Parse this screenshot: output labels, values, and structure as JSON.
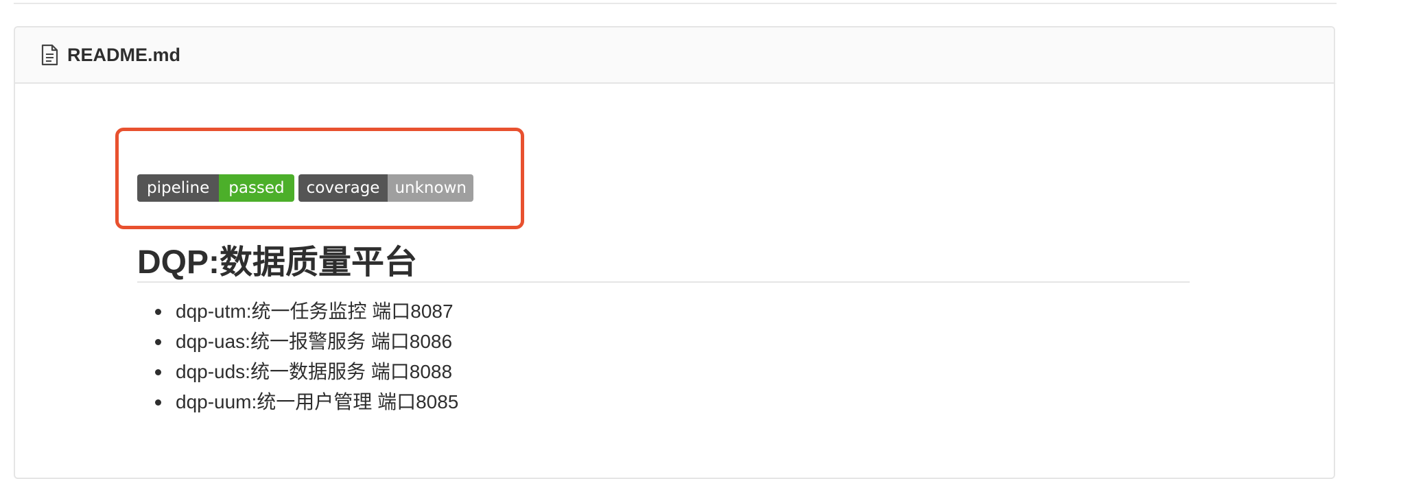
{
  "file": {
    "icon": "file-text-icon",
    "name": "README.md"
  },
  "badges": [
    {
      "label": "pipeline",
      "value": "passed",
      "color": "#4caf2a"
    },
    {
      "label": "coverage",
      "value": "unknown",
      "color": "#9f9f9f"
    }
  ],
  "highlight_color": "#e8512f",
  "readme": {
    "title": "DQP:数据质量平台",
    "items": [
      "dqp-utm:统一任务监控 端口8087",
      "dqp-uas:统一报警服务 端口8086",
      "dqp-uds:统一数据服务 端口8088",
      "dqp-uum:统一用户管理 端口8085"
    ]
  }
}
